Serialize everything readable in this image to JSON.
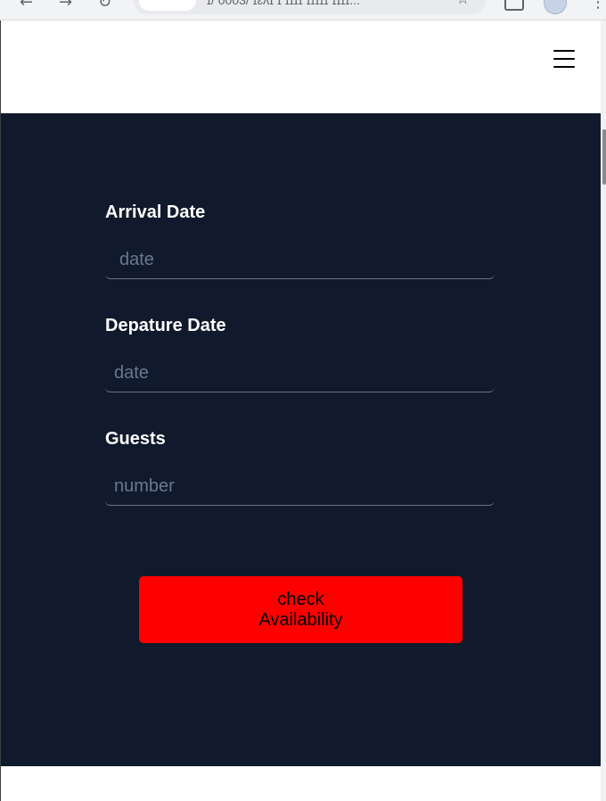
{
  "browser": {
    "url": "ɪ/ 0003/ ɪɛʌɪ ɪ ɪɪɪɪ ɪɪɪɪɪ ɪɪɪɪ..."
  },
  "header": {
    "menu_icon": "hamburger-menu-icon"
  },
  "form": {
    "arrival": {
      "label": "Arrival Date",
      "placeholder": "date"
    },
    "departure": {
      "label": "Depature Date",
      "placeholder": "date"
    },
    "guests": {
      "label": "Guests",
      "placeholder": "number"
    },
    "submit": {
      "line1": "check",
      "line2": "Availability"
    }
  },
  "colors": {
    "form_background": "#101a2c",
    "button_background": "#ff0000",
    "label_text": "#ffffff"
  }
}
